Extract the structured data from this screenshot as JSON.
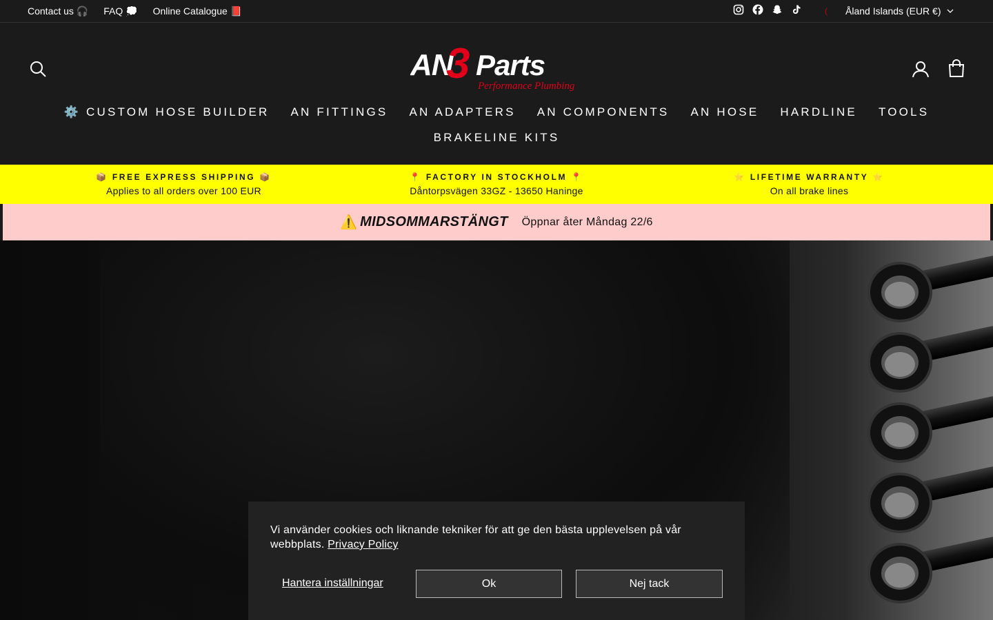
{
  "utility": {
    "links": [
      "Contact us 🎧",
      "FAQ 💭",
      "Online Catalogue 📕"
    ],
    "social_icons": [
      "instagram-icon",
      "facebook-icon",
      "snapchat-icon",
      "tiktok-icon"
    ],
    "currency": "Åland Islands (EUR €)"
  },
  "header": {
    "logo_main": "AN3 Parts",
    "logo_tagline": "Performance Plumbing",
    "icons": [
      "search-icon",
      "account-icon",
      "cart-icon"
    ],
    "login_label": "LOG IN",
    "cart_label": "CART"
  },
  "nav": {
    "row1": [
      "⚙️ CUSTOM HOSE BUILDER",
      "AN FITTINGS",
      "AN ADAPTERS",
      "AN COMPONENTS",
      "AN HOSE",
      "HARDLINE",
      "TOOLS"
    ],
    "row2": [
      "BRAKELINE KITS"
    ]
  },
  "promo": [
    {
      "title": "📦 FREE EXPRESS SHIPPING 📦",
      "sub": "Applies to all orders over 100 EUR"
    },
    {
      "title": "📍 FACTORY IN STOCKHOLM 📍",
      "sub": "Dåntorpsvägen 33GZ - 13650 Haninge"
    },
    {
      "title": "⭐ LIFETIME WARRANTY ⭐",
      "sub": "On all brake lines"
    }
  ],
  "notice": {
    "icon": "⚠️",
    "title": "MIDSOMMARSTÄNGT",
    "text": "Öppnar åter Måndag 22/6"
  },
  "cookie": {
    "message": "Vi använder cookies och liknande tekniker för att ge den bästa upplevelsen på vår webbplats.",
    "privacy_link": "Privacy Policy",
    "manage": "Hantera inställningar",
    "ok": "Ok",
    "decline": "Nej tack"
  },
  "colors": {
    "header_bg": "#1b1b1b",
    "promo_bg": "#ffff00",
    "notice_bg": "#ffcccc",
    "logo_accent": "#e0001a"
  }
}
